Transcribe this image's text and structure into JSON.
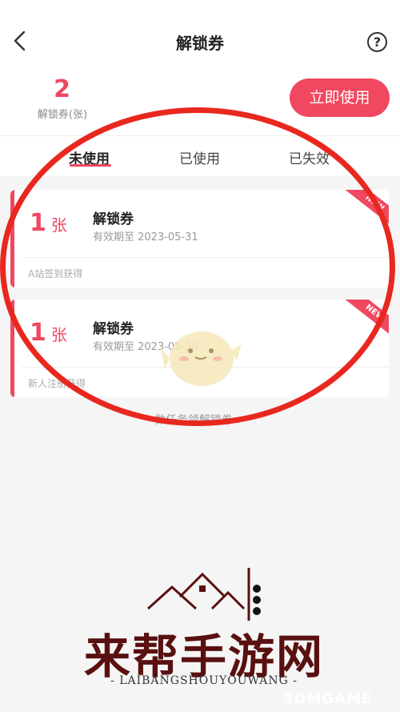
{
  "header": {
    "title": "解锁券",
    "help_icon_label": "?"
  },
  "summary": {
    "count": "2",
    "count_label": "解锁券(张)",
    "use_button": "立即使用"
  },
  "tabs": [
    {
      "label": "未使用",
      "active": true
    },
    {
      "label": "已使用",
      "active": false
    },
    {
      "label": "已失效",
      "active": false
    }
  ],
  "coupons": [
    {
      "quantity": "1",
      "unit": "张",
      "name": "解锁券",
      "expiry": "有效期至 2023-05-31",
      "source": "A站签到获得",
      "badge": "NEW"
    },
    {
      "quantity": "1",
      "unit": "张",
      "name": "解锁券",
      "expiry": "有效期至 2023-05-30",
      "source": "新人注册获得",
      "badge": "NEW"
    }
  ],
  "task_link": "做任务领解锁券 >",
  "watermark": {
    "title": "来帮手游网",
    "subtitle": "- LAIBANGSHOUYOUWANG -",
    "brand": "3DMGAME"
  },
  "colors": {
    "accent": "#ef4860",
    "annotation": "#e8281f"
  }
}
